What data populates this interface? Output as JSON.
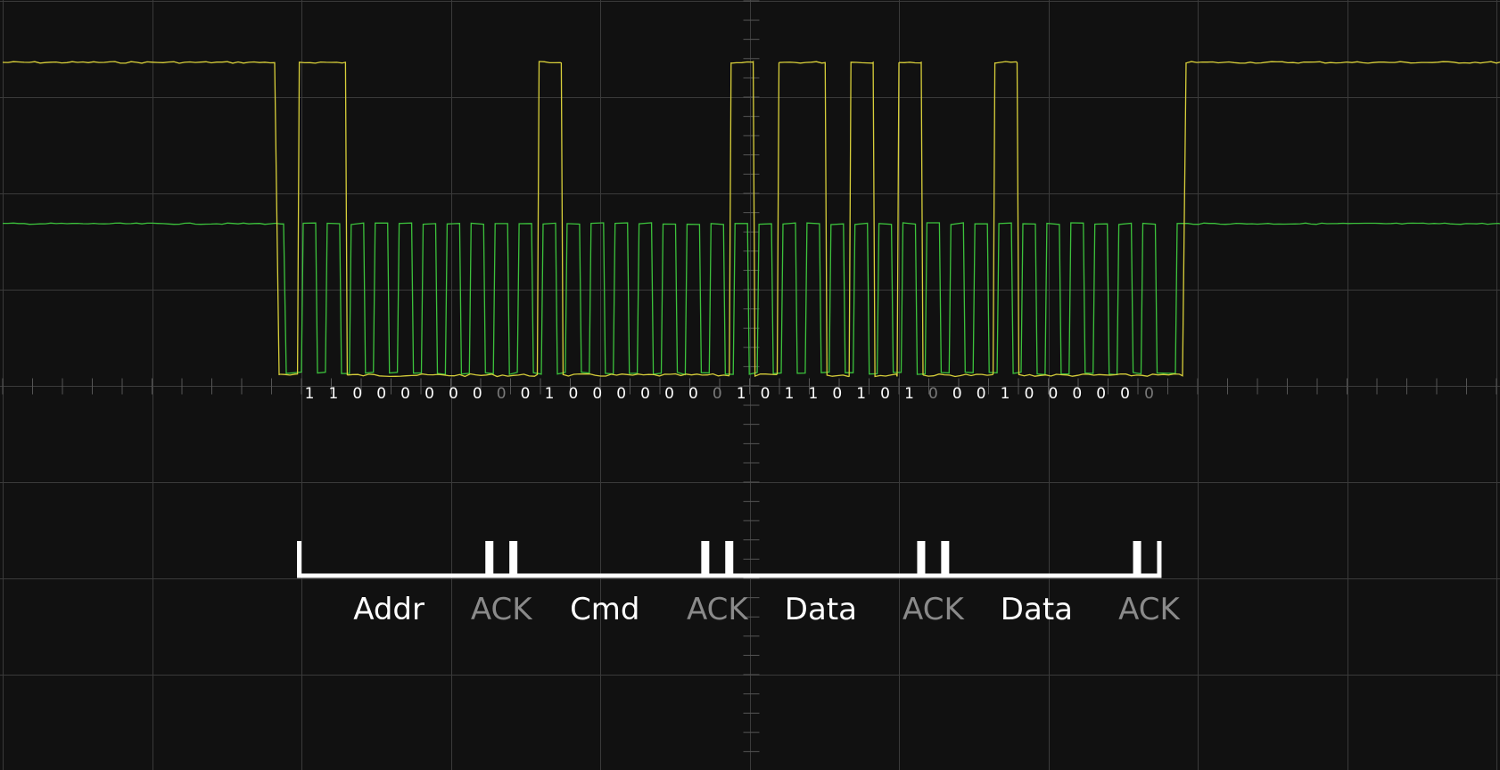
{
  "colors": {
    "background": "#111111",
    "grid": "#3a3a3a",
    "axis": "#555555",
    "sda_trace": "#d8cf3a",
    "scl_trace": "#3cc23c",
    "bit_value": "#ffffff",
    "ack_bit": "#7a7a7a",
    "bracket": "#ffffff",
    "data_label": "#ffffff",
    "ack_label": "#8a8a8a"
  },
  "chart_data": {
    "type": "line",
    "grid": true,
    "divisions": {
      "horizontal": 10,
      "vertical": 8
    },
    "series": [],
    "bits": [
      "1",
      "1",
      "0",
      "0",
      "0",
      "0",
      "0",
      "0",
      "0",
      "0",
      "1",
      "0",
      "0",
      "0",
      "0",
      "0",
      "0",
      "0",
      "1",
      "0",
      "1",
      "1",
      "0",
      "1",
      "0",
      "1",
      "0",
      "0",
      "0",
      "1",
      "0",
      "0",
      "0",
      "0",
      "0",
      "0"
    ],
    "ack_bit_indices": [
      8,
      17,
      26,
      35
    ],
    "segments": [
      {
        "label": "Addr",
        "kind": "data",
        "start_bit": 0,
        "end_bit": 7
      },
      {
        "label": "ACK",
        "kind": "ack",
        "start_bit": 8,
        "end_bit": 8
      },
      {
        "label": "Cmd",
        "kind": "data",
        "start_bit": 9,
        "end_bit": 16
      },
      {
        "label": "ACK",
        "kind": "ack",
        "start_bit": 17,
        "end_bit": 17
      },
      {
        "label": "Data",
        "kind": "data",
        "start_bit": 18,
        "end_bit": 25
      },
      {
        "label": "ACK",
        "kind": "ack",
        "start_bit": 26,
        "end_bit": 26
      },
      {
        "label": "Data",
        "kind": "data",
        "start_bit": 27,
        "end_bit": 34
      },
      {
        "label": "ACK",
        "kind": "ack",
        "start_bit": 35,
        "end_bit": 35
      }
    ]
  }
}
